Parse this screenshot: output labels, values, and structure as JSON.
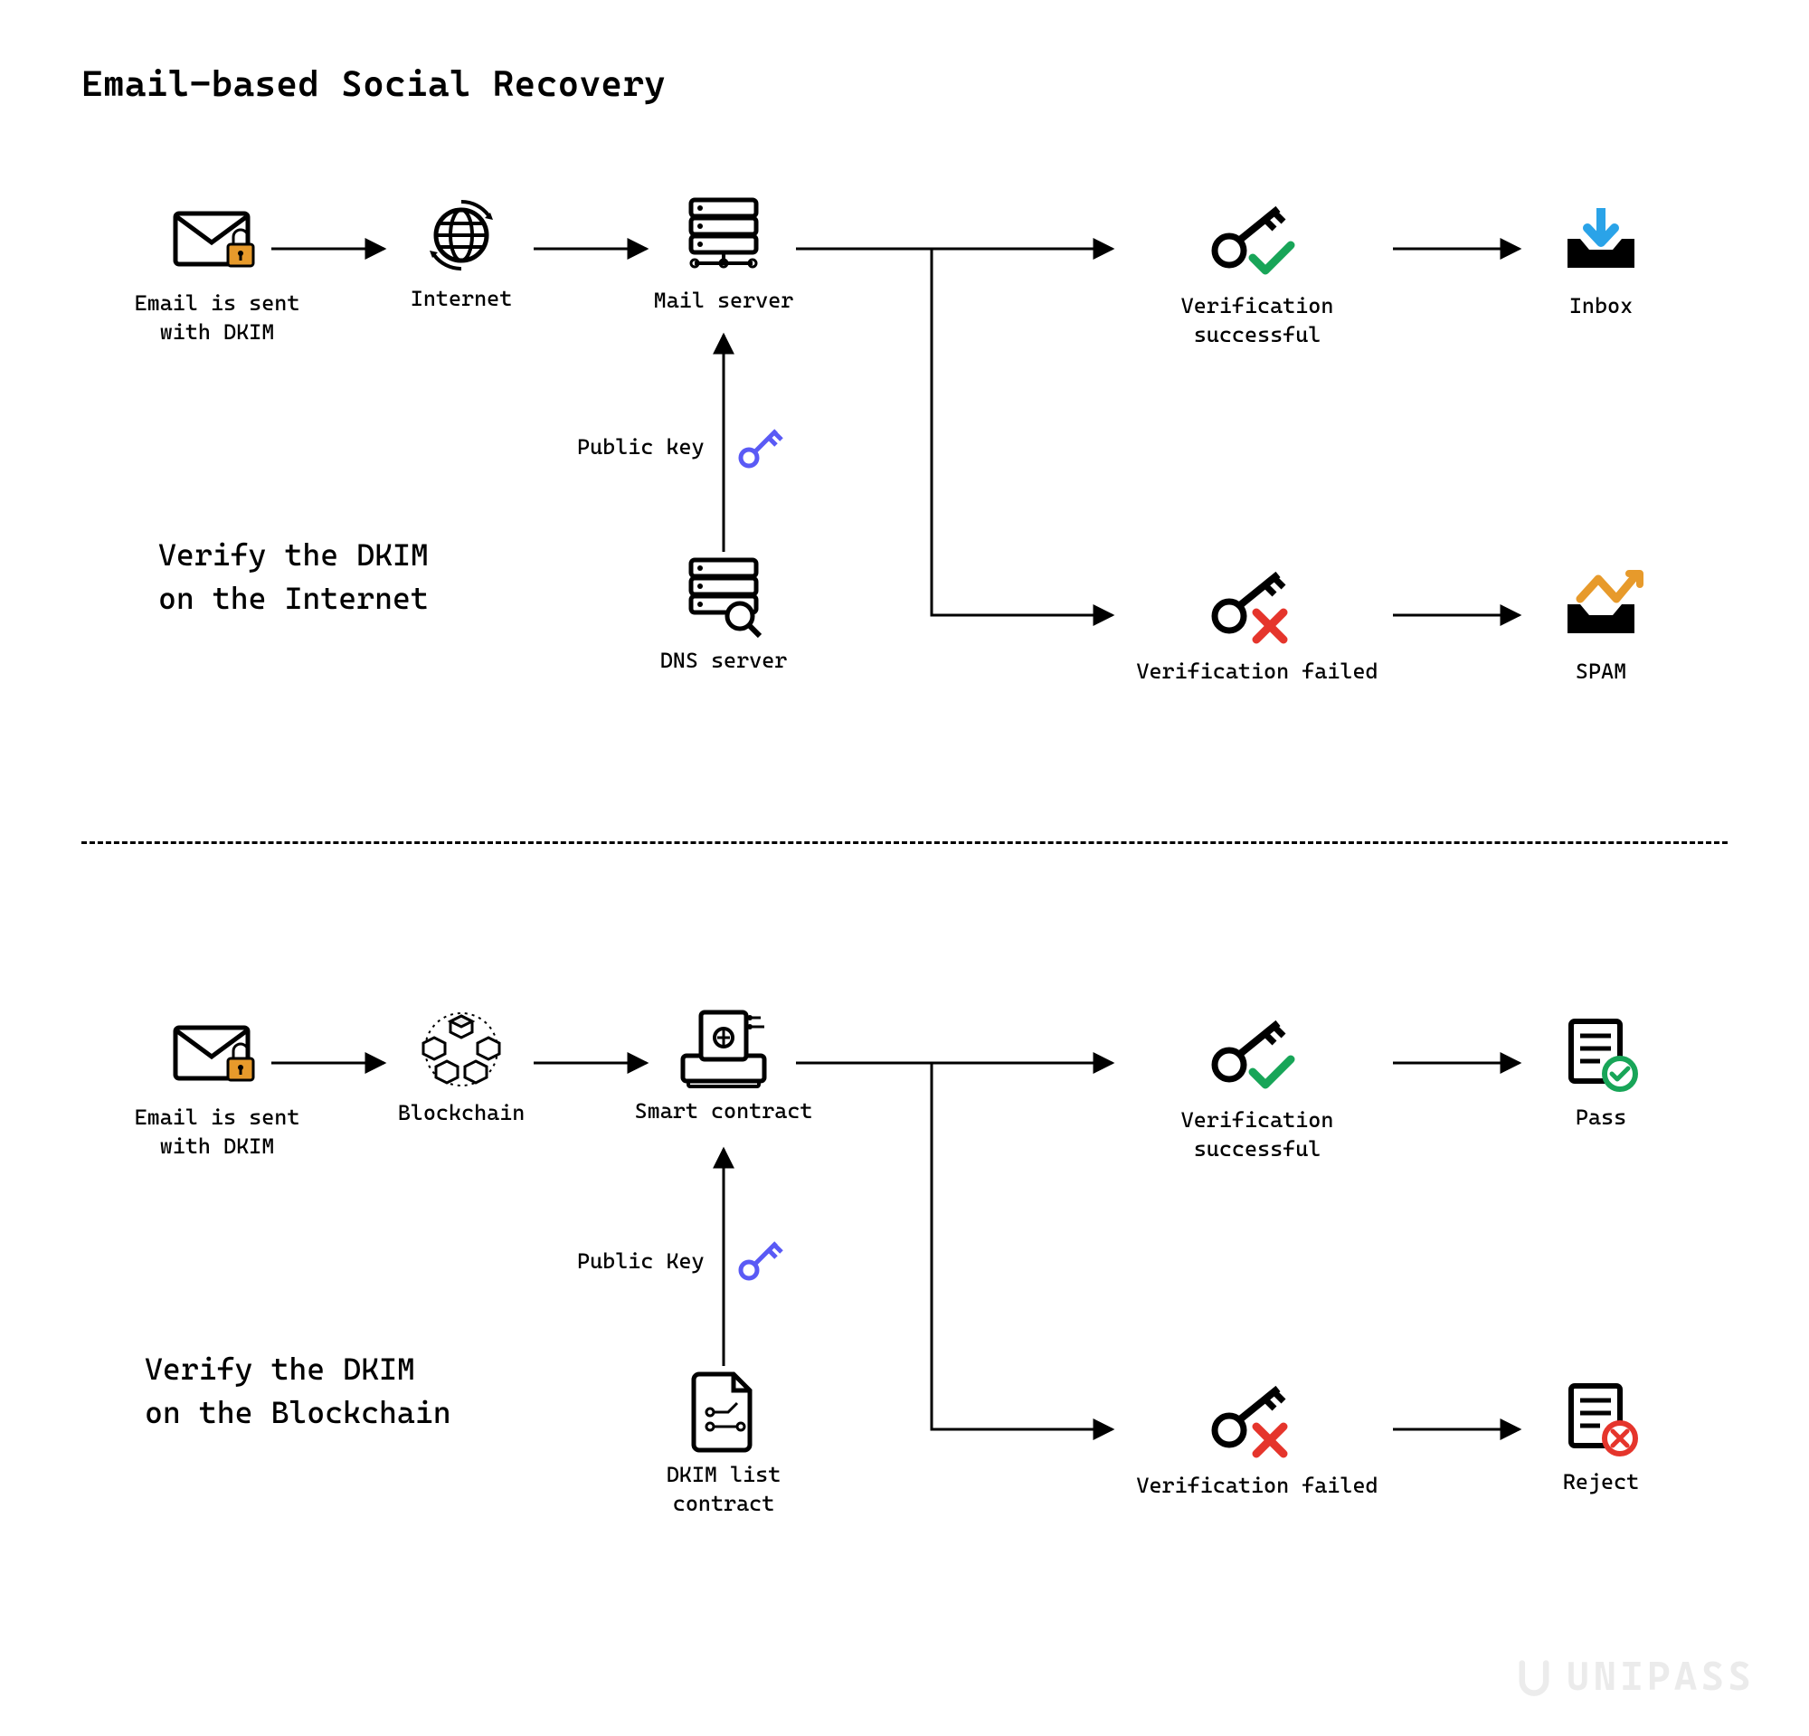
{
  "title": "Email-based Social Recovery",
  "watermark": "UNIPASS",
  "section1": {
    "label": "Verify the DKIM\non the Internet",
    "pubkey_label": "Public key",
    "email": "Email is sent\nwith DKIM",
    "internet": "Internet",
    "mailserver": "Mail server",
    "dns": "DNS server",
    "verif_ok": "Verification successful",
    "verif_fail": "Verification failed",
    "inbox": "Inbox",
    "spam": "SPAM"
  },
  "section2": {
    "label": "Verify the DKIM\non the Blockchain",
    "pubkey_label": "Public Key",
    "email": "Email is sent\nwith DKIM",
    "blockchain": "Blockchain",
    "contract": "Smart contract",
    "dkim_contract": "DKIM list contract",
    "verif_ok": "Verification successful",
    "verif_fail": "Verification failed",
    "pass": "Pass",
    "reject": "Reject"
  }
}
